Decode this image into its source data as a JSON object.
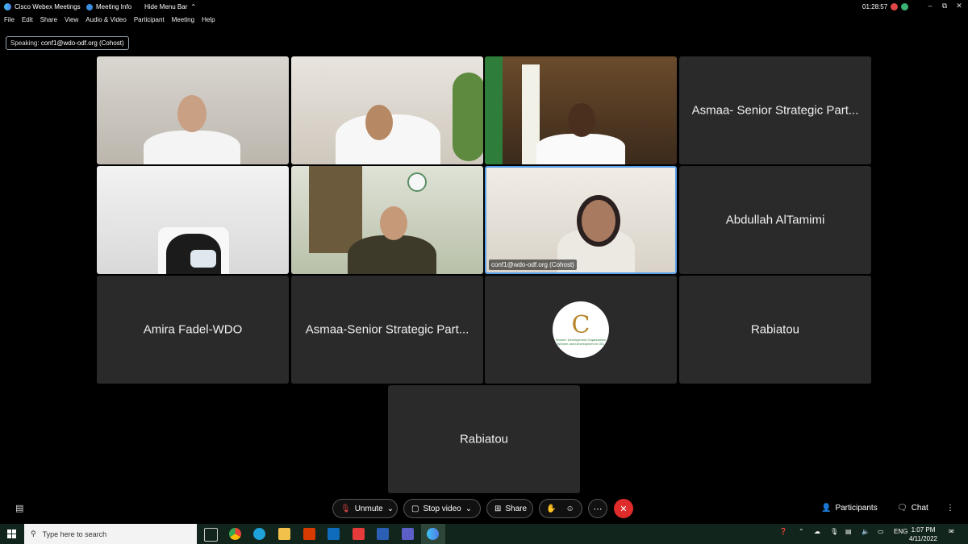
{
  "titlebar": {
    "app_name": "Cisco Webex Meetings",
    "meeting_info": "Meeting Info",
    "hide_menu": "Hide Menu Bar",
    "timer": "01:28:57"
  },
  "menu": [
    "File",
    "Edit",
    "Share",
    "View",
    "Audio & Video",
    "Participant",
    "Meeting",
    "Help"
  ],
  "speaking": {
    "label": "Speaking:",
    "name": "conf1@wdo-odf.org (Cohost)"
  },
  "tiles": {
    "t4": "Asmaa- Senior Strategic Part...",
    "t7_label": "conf1@wdo-odf.org (Cohost)",
    "t8": "Abdullah AlTamimi",
    "t9": "Amira Fadel-WDO",
    "t10": "Asmaa-Senior Strategic Part...",
    "t12": "Rabiatou",
    "t13": "Rabiatou",
    "logo_line1": "Women Development Organization",
    "logo_line2": "Women and Development in OIC"
  },
  "controls": {
    "unmute": "Unmute",
    "stop_video": "Stop video",
    "share": "Share",
    "participants": "Participants",
    "chat": "Chat"
  },
  "taskbar": {
    "search_placeholder": "Type here to search",
    "lang": "ENG",
    "time": "1:07 PM",
    "date": "4/11/2022"
  },
  "colors": {
    "end_call": "#e02b2b",
    "active_border": "#5aa0e8",
    "tile_bg": "#2a2a2a"
  }
}
